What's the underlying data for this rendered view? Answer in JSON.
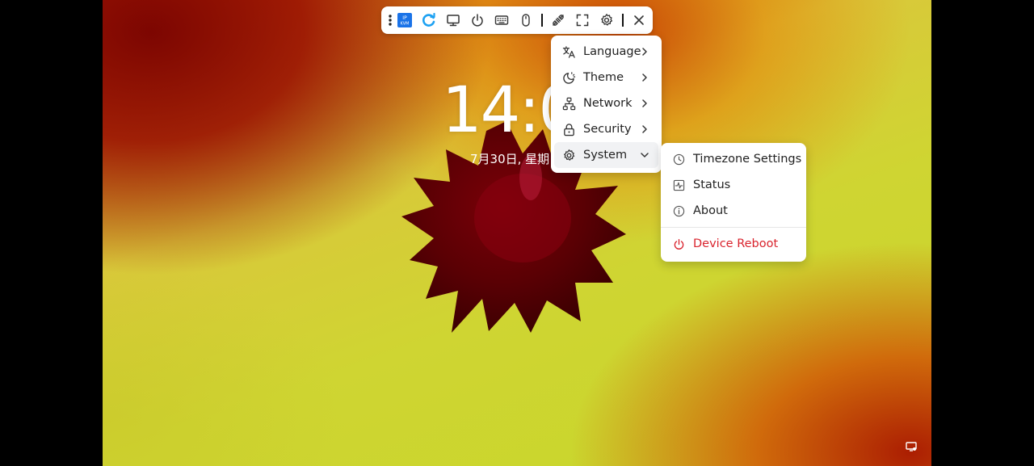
{
  "toolbar": {
    "kvm_logo_text": "IP KVM",
    "icons": [
      "more-vertical-icon",
      "kvm-logo-icon",
      "refresh-icon",
      "monitor-icon",
      "power-icon",
      "keyboard-icon",
      "mouse-icon",
      "separator",
      "disconnect-icon",
      "fullscreen-icon",
      "gear-icon",
      "separator",
      "close-icon"
    ]
  },
  "screen": {
    "clock_text": "14:0",
    "date_text": "7月30日, 星期"
  },
  "menu": {
    "items": [
      {
        "label": "Language",
        "icon": "language-icon"
      },
      {
        "label": "Theme",
        "icon": "theme-icon"
      },
      {
        "label": "Network",
        "icon": "network-icon"
      },
      {
        "label": "Security",
        "icon": "lock-icon"
      },
      {
        "label": "System",
        "icon": "gear-icon",
        "expanded": true
      }
    ]
  },
  "system_submenu": {
    "items": [
      {
        "label": "Timezone Settings",
        "icon": "clock-icon"
      },
      {
        "label": "Status",
        "icon": "activity-icon"
      },
      {
        "label": "About",
        "icon": "info-icon"
      }
    ],
    "reboot_label": "Device Reboot",
    "reboot_color": "#d9232d"
  },
  "colors": {
    "accent_blue": "#1a73e8",
    "refresh_blue": "#1da1f2"
  }
}
